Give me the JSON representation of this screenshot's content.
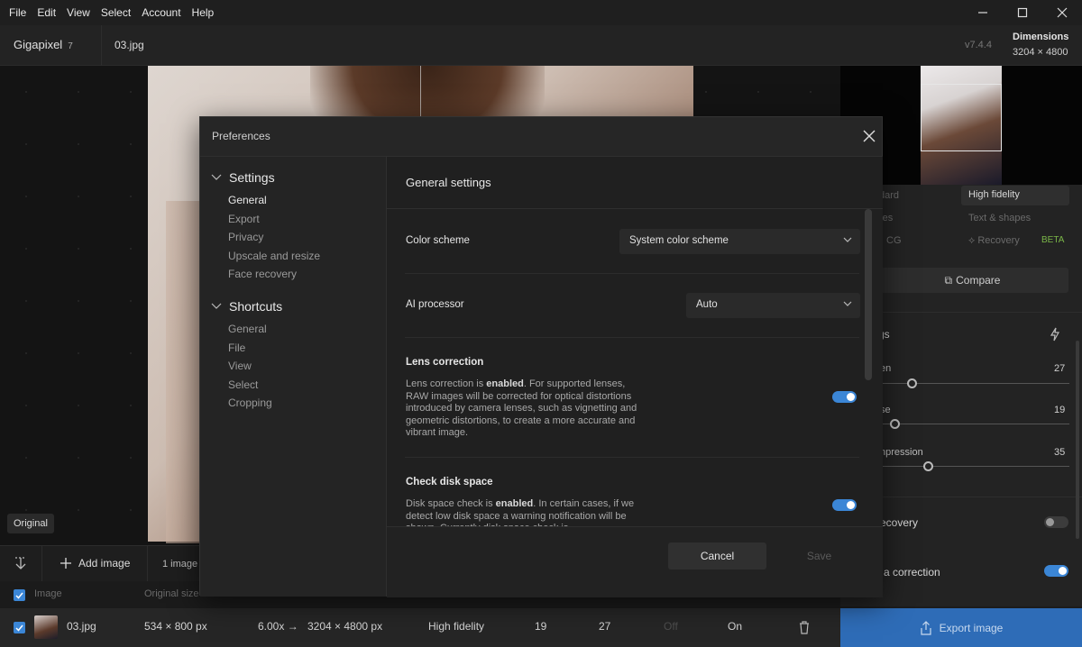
{
  "menu": [
    "File",
    "Edit",
    "View",
    "Select",
    "Account",
    "Help"
  ],
  "header": {
    "app_name": "Gigapixel",
    "app_version_badge": "7",
    "filename": "03.jpg",
    "version": "v7.4.4",
    "dimensions_label": "Dimensions",
    "dimensions_value": "3204 × 4800"
  },
  "canvas": {
    "original_tag": "Original"
  },
  "right_panel": {
    "model_left_1": "dard",
    "model_high_fidelity": "High fidelity",
    "model_left_2": "res",
    "model_text_shapes": "Text & shapes",
    "model_left_3": "CG",
    "model_recovery": "Recovery",
    "beta": "BETA",
    "compare": "Compare",
    "settings_label": "gs",
    "slider_1_label": "en",
    "slider_1_value": "27",
    "slider_1_level": 0.2,
    "slider_2_label": "se",
    "slider_2_value": "19",
    "slider_2_level": 0.08,
    "slider_3_label": "npression",
    "slider_3_value": "35",
    "slider_3_level": 0.33,
    "toggle_1_label": "ecovery",
    "toggle_1_on": false,
    "toggle_2_label": "a correction",
    "toggle_2_on": true,
    "export": "Export image"
  },
  "bottom": {
    "add_image": "Add image",
    "image_count": "1 image",
    "table_headers": [
      "Image",
      "Original size"
    ],
    "row": {
      "name": "03.jpg",
      "original_size": "534 × 800 px",
      "scale": "6.00x →",
      "output_size": "3204 × 4800 px",
      "model": "High fidelity",
      "v1": "19",
      "v2": "27",
      "v3": "Off",
      "v4": "On"
    }
  },
  "modal": {
    "title": "Preferences",
    "sections": [
      {
        "label": "Settings",
        "items": [
          "General",
          "Export",
          "Privacy",
          "Upscale and resize",
          "Face recovery"
        ]
      },
      {
        "label": "Shortcuts",
        "items": [
          "General",
          "File",
          "View",
          "Select",
          "Cropping"
        ]
      }
    ],
    "active_item": "General",
    "content_title": "General settings",
    "color_scheme_label": "Color scheme",
    "color_scheme_value": "System color scheme",
    "ai_processor_label": "AI processor",
    "ai_processor_value": "Auto",
    "lens_title": "Lens correction",
    "lens_desc_pre": "Lens correction is ",
    "lens_desc_bold": "enabled",
    "lens_desc_post": ". For supported lenses, RAW images will be corrected for optical distortions introduced by camera lenses, such as vignetting and geometric distortions, to create a more accurate and vibrant image.",
    "lens_on": true,
    "disk_title": "Check disk space",
    "disk_desc_pre": "Disk space check is ",
    "disk_desc_bold": "enabled",
    "disk_desc_post": ". In certain cases, if we detect low disk space a warning notification will be shown. Currently disk space check is",
    "disk_on": true,
    "cancel": "Cancel",
    "save": "Save"
  },
  "colors": {
    "accent": "#3b86d6",
    "export_bg": "#2e6cb7",
    "beta": "#7ab648"
  }
}
